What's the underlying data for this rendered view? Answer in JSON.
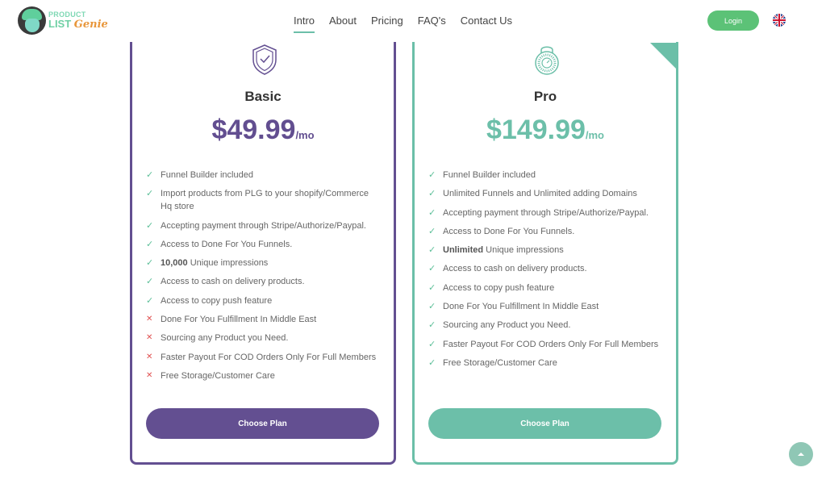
{
  "header": {
    "logo": {
      "line1": "PRODUCT",
      "line2a": "LIST",
      "line2b": "Genie"
    },
    "nav": [
      {
        "label": "Intro",
        "active": true
      },
      {
        "label": "About"
      },
      {
        "label": "Pricing"
      },
      {
        "label": "FAQ's"
      },
      {
        "label": "Contact Us"
      }
    ],
    "login_label": "Login",
    "language_icon": "uk-flag-icon"
  },
  "plans": [
    {
      "name": "Basic",
      "price": "$49.99",
      "period": "/mo",
      "color": "#634f91",
      "icon": "shield-check-icon",
      "button": "Choose Plan",
      "features": [
        {
          "included": true,
          "bold": "",
          "text": "Funnel Builder included"
        },
        {
          "included": true,
          "bold": "",
          "text": "Import products from PLG to your shopify/Commerce Hq store"
        },
        {
          "included": true,
          "bold": "",
          "text": "Accepting payment through Stripe/Authorize/Paypal."
        },
        {
          "included": true,
          "bold": "",
          "text": "Access to Done For You Funnels."
        },
        {
          "included": true,
          "bold": "10,000",
          "text": " Unique impressions"
        },
        {
          "included": true,
          "bold": "",
          "text": "Access to cash on delivery products."
        },
        {
          "included": true,
          "bold": "",
          "text": "Access to copy push feature"
        },
        {
          "included": false,
          "bold": "",
          "text": "Done For You Fulfillment In Middle East"
        },
        {
          "included": false,
          "bold": "",
          "text": "Sourcing any Product you Need."
        },
        {
          "included": false,
          "bold": "",
          "text": "Faster Payout For COD Orders Only For Full Members"
        },
        {
          "included": false,
          "bold": "",
          "text": "Free Storage/Customer Care"
        }
      ]
    },
    {
      "name": "Pro",
      "price": "$149.99",
      "period": "/mo",
      "color": "#6bbfa8",
      "icon": "combination-lock-icon",
      "button": "Choose Plan",
      "features": [
        {
          "included": true,
          "bold": "",
          "text": "Funnel Builder included"
        },
        {
          "included": true,
          "bold": "",
          "text": "Unlimited Funnels and Unlimited adding Domains"
        },
        {
          "included": true,
          "bold": "",
          "text": "Accepting payment through Stripe/Authorize/Paypal."
        },
        {
          "included": true,
          "bold": "",
          "text": "Access to Done For You Funnels."
        },
        {
          "included": true,
          "bold": "Unlimited",
          "text": " Unique impressions"
        },
        {
          "included": true,
          "bold": "",
          "text": "Access to cash on delivery products."
        },
        {
          "included": true,
          "bold": "",
          "text": "Access to copy push feature"
        },
        {
          "included": true,
          "bold": "",
          "text": "Done For You Fulfillment In Middle East"
        },
        {
          "included": true,
          "bold": "",
          "text": "Sourcing any Product you Need."
        },
        {
          "included": true,
          "bold": "",
          "text": "Faster Payout For COD Orders Only For Full Members"
        },
        {
          "included": true,
          "bold": "",
          "text": "Free Storage/Customer Care"
        }
      ]
    }
  ],
  "scroll_top_icon": "chevron-up-icon"
}
